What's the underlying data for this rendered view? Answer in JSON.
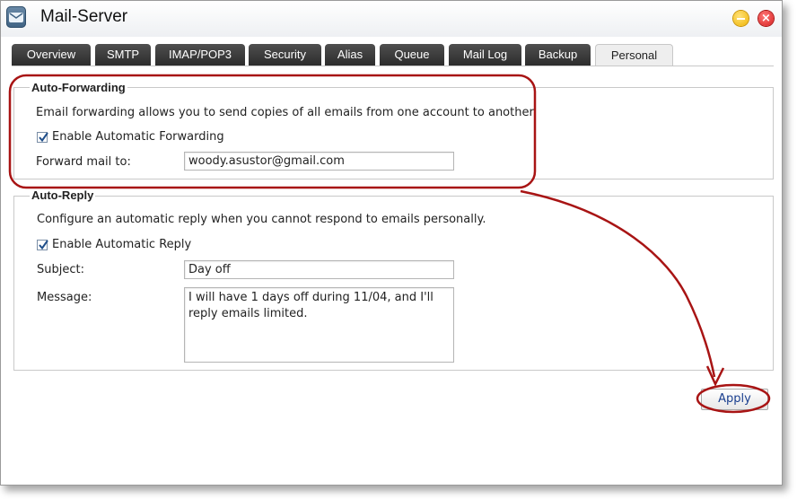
{
  "window": {
    "title": "Mail-Server",
    "icon": "mail-server-app-icon"
  },
  "tabs": [
    {
      "label": "Overview",
      "active": false
    },
    {
      "label": "SMTP",
      "active": false
    },
    {
      "label": "IMAP/POP3",
      "active": false
    },
    {
      "label": "Security",
      "active": false
    },
    {
      "label": "Alias",
      "active": false
    },
    {
      "label": "Queue",
      "active": false
    },
    {
      "label": "Mail Log",
      "active": false
    },
    {
      "label": "Backup",
      "active": false
    },
    {
      "label": "Personal",
      "active": true
    }
  ],
  "forwarding": {
    "legend": "Auto-Forwarding",
    "description": "Email forwarding allows you to send copies of all emails from one account to another.",
    "enable_label": "Enable Automatic Forwarding",
    "enabled": true,
    "forward_label": "Forward mail to:",
    "forward_value": "woody.asustor@gmail.com"
  },
  "reply": {
    "legend": "Auto-Reply",
    "description": "Configure an automatic reply when you cannot respond to emails personally.",
    "enable_label": "Enable Automatic Reply",
    "enabled": true,
    "subject_label": "Subject:",
    "subject_value": "Day off",
    "message_label": "Message:",
    "message_value": "I will have 1 days off during 11/04, and I'll\nreply emails limited."
  },
  "actions": {
    "apply_label": "Apply"
  },
  "annotation_color": "#a81414"
}
